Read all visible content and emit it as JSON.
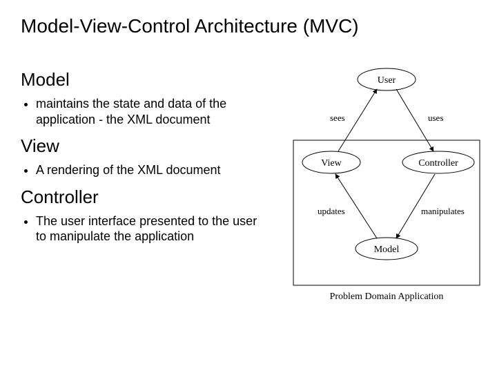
{
  "title": "Model-View-Control Architecture  (MVC)",
  "sections": {
    "model": {
      "heading": "Model",
      "bullet": "maintains the state and data of the application - the XML document"
    },
    "view": {
      "heading": "View",
      "bullet": "A rendering of the XML document"
    },
    "controller": {
      "heading": "Controller",
      "bullet": "The user interface presented to the user to manipulate the application"
    }
  },
  "diagram": {
    "nodes": {
      "user": "User",
      "view": "View",
      "controller": "Controller",
      "model": "Model"
    },
    "edges": {
      "sees": "sees",
      "uses": "uses",
      "updates": "updates",
      "manipulates": "manipulates"
    },
    "app_box_label": "Problem Domain Application"
  }
}
